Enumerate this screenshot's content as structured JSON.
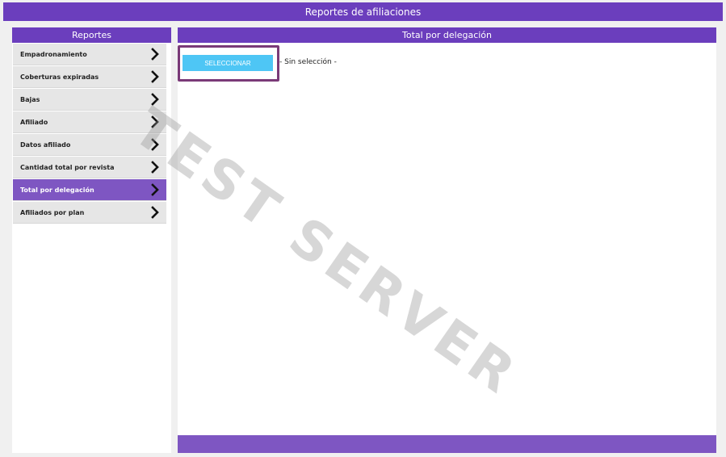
{
  "header": {
    "title": "Reportes de afiliaciones"
  },
  "sidebar": {
    "title": "Reportes",
    "items": [
      {
        "label": "Empadronamiento",
        "active": false
      },
      {
        "label": "Coberturas expiradas",
        "active": false
      },
      {
        "label": "Bajas",
        "active": false
      },
      {
        "label": "Afiliado",
        "active": false
      },
      {
        "label": "Datos afiliado",
        "active": false
      },
      {
        "label": "Cantidad total por revista",
        "active": false
      },
      {
        "label": "Total por delegación",
        "active": true
      },
      {
        "label": "Afiliados por plan",
        "active": false
      }
    ]
  },
  "main": {
    "title": "Total por delegación",
    "select_button": "SELECCIONAR",
    "selection_text": "- Sin selección -"
  },
  "watermark": "TEST SERVER",
  "colors": {
    "primary": "#6b3ebd",
    "active_item": "#7e56c2",
    "button": "#4ec6f5",
    "highlight_border": "#7a3a78"
  }
}
